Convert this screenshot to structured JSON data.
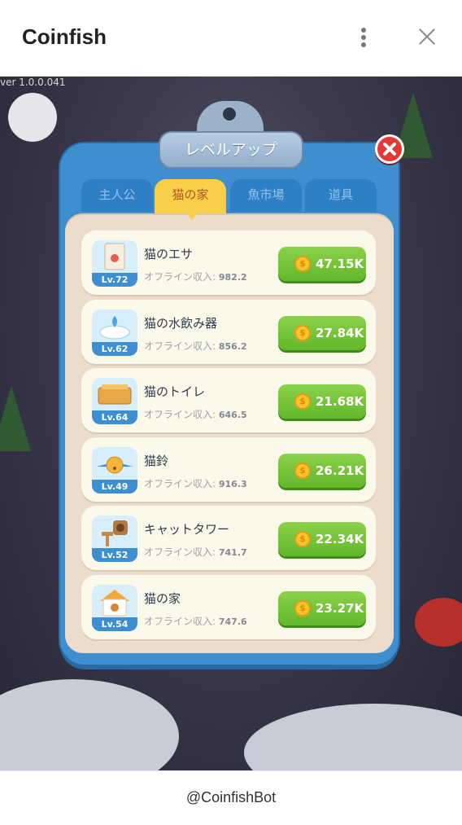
{
  "header": {
    "title": "Coinfish",
    "menu_icon": "kebab-menu-icon",
    "close_icon": "close-icon"
  },
  "game": {
    "version": "ver 1.0.0.041",
    "dialog": {
      "title": "レベルアップ",
      "tabs": [
        {
          "label": "主人公",
          "active": false
        },
        {
          "label": "猫の家",
          "active": true
        },
        {
          "label": "魚市場",
          "active": false
        },
        {
          "label": "道具",
          "active": false
        }
      ],
      "offline_label": "オフライン収入:",
      "items": [
        {
          "name": "猫のエサ",
          "level": "Lv.72",
          "offline": "982.2",
          "price": "47.15K",
          "icon": "cat-food-bag-icon"
        },
        {
          "name": "猫の水飲み器",
          "level": "Lv.62",
          "offline": "856.2",
          "price": "27.84K",
          "icon": "water-fountain-icon"
        },
        {
          "name": "猫のトイレ",
          "level": "Lv.64",
          "offline": "646.5",
          "price": "21.68K",
          "icon": "litter-box-icon"
        },
        {
          "name": "猫鈴",
          "level": "Lv.49",
          "offline": "916.3",
          "price": "26.21K",
          "icon": "cat-bell-icon"
        },
        {
          "name": "キャットタワー",
          "level": "Lv.52",
          "offline": "741.7",
          "price": "22.34K",
          "icon": "cat-tower-icon"
        },
        {
          "name": "猫の家",
          "level": "Lv.54",
          "offline": "747.6",
          "price": "23.27K",
          "icon": "cat-house-icon"
        }
      ]
    }
  },
  "footer": {
    "text": "@CoinfishBot"
  },
  "colors": {
    "panel_blue": "#3f8fd0",
    "active_tab": "#f9cf4a",
    "buy_green": "#63b62a",
    "close_red": "#e53935"
  }
}
